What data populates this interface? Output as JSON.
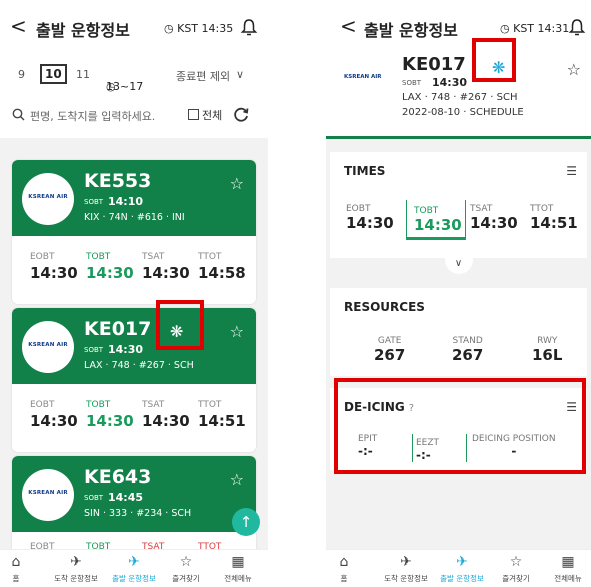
{
  "left": {
    "header": {
      "back": "<",
      "title": "출발 운항정보",
      "clock": "KST 14:35"
    },
    "datebar": {
      "prev": "9",
      "selected": "10",
      "next": "11",
      "time_range": "13~17",
      "filter": "종료편 제외",
      "chevron": "∨"
    },
    "search": {
      "placeholder": "편명, 도착지를 입력하세요.",
      "all_label": "전체"
    },
    "cards": [
      {
        "logo": "KSREAN AIR",
        "flight": "KE553",
        "sobt_label": "SOBT",
        "sobt": "14:10",
        "route": "KIX · 74N · #616 · INI",
        "times": [
          {
            "label": "EOBT",
            "value": "14:30"
          },
          {
            "label": "TOBT",
            "value": "14:30"
          },
          {
            "label": "TSAT",
            "value": "14:30"
          },
          {
            "label": "TTOT",
            "value": "14:58"
          }
        ]
      },
      {
        "logo": "KSREAN AIR",
        "flight": "KE017",
        "sobt_label": "SOBT",
        "sobt": "14:30",
        "route": "LAX · 748 · #267 · SCH",
        "times": [
          {
            "label": "EOBT",
            "value": "14:30"
          },
          {
            "label": "TOBT",
            "value": "14:30"
          },
          {
            "label": "TSAT",
            "value": "14:30"
          },
          {
            "label": "TTOT",
            "value": "14:51"
          }
        ]
      },
      {
        "logo": "KSREAN AIR",
        "flight": "KE643",
        "sobt_label": "SOBT",
        "sobt": "14:45",
        "route": "SIN · 333 · #234 · SCH",
        "times": [
          {
            "label": "EOBT",
            "value": ""
          },
          {
            "label": "TOBT",
            "value": ""
          },
          {
            "label": "TSAT",
            "value": ""
          },
          {
            "label": "TTOT",
            "value": ""
          }
        ]
      }
    ],
    "fab": "↑"
  },
  "right": {
    "header": {
      "back": "<",
      "title": "출발 운항정보",
      "clock": "KST 14:31"
    },
    "flight": {
      "logo": "KSREAN AIR",
      "number": "KE017",
      "sobt_label": "SOBT",
      "sobt": "14:30",
      "route": "LAX · 748 · #267 · SCH",
      "date_status": "2022-08-10 · SCHEDULE"
    },
    "times": {
      "title": "TIMES",
      "items": [
        {
          "label": "EOBT",
          "value": "14:30"
        },
        {
          "label": "TOBT",
          "value": "14:30"
        },
        {
          "label": "TSAT",
          "value": "14:30"
        },
        {
          "label": "TTOT",
          "value": "14:51"
        }
      ]
    },
    "resources": {
      "title": "RESOURCES",
      "items": [
        {
          "label": "GATE",
          "value": "267"
        },
        {
          "label": "STAND",
          "value": "267"
        },
        {
          "label": "RWY",
          "value": "16L"
        }
      ]
    },
    "deicing": {
      "title": "DE-ICING",
      "help": "?",
      "items": [
        {
          "label": "EPIT",
          "value": "-:-"
        },
        {
          "label": "EEZT",
          "value": "-:-"
        },
        {
          "label": "DEICING POSITION",
          "value": "-"
        }
      ]
    }
  },
  "nav": [
    {
      "icon": "home-icon",
      "label": "홈"
    },
    {
      "icon": "arrival-plane-icon",
      "label": "도착 운항정보"
    },
    {
      "icon": "departure-plane-icon",
      "label": "출발 운항정보"
    },
    {
      "icon": "star-icon",
      "label": "즐겨찾기"
    },
    {
      "icon": "grid-menu-icon",
      "label": "전체메뉴"
    }
  ],
  "colors": {
    "card_green": "#128149",
    "accent_green": "#1a9a5c",
    "active_blue": "#1aa7d9",
    "highlight_red": "#e00000",
    "ttot_red": "#d94040"
  }
}
